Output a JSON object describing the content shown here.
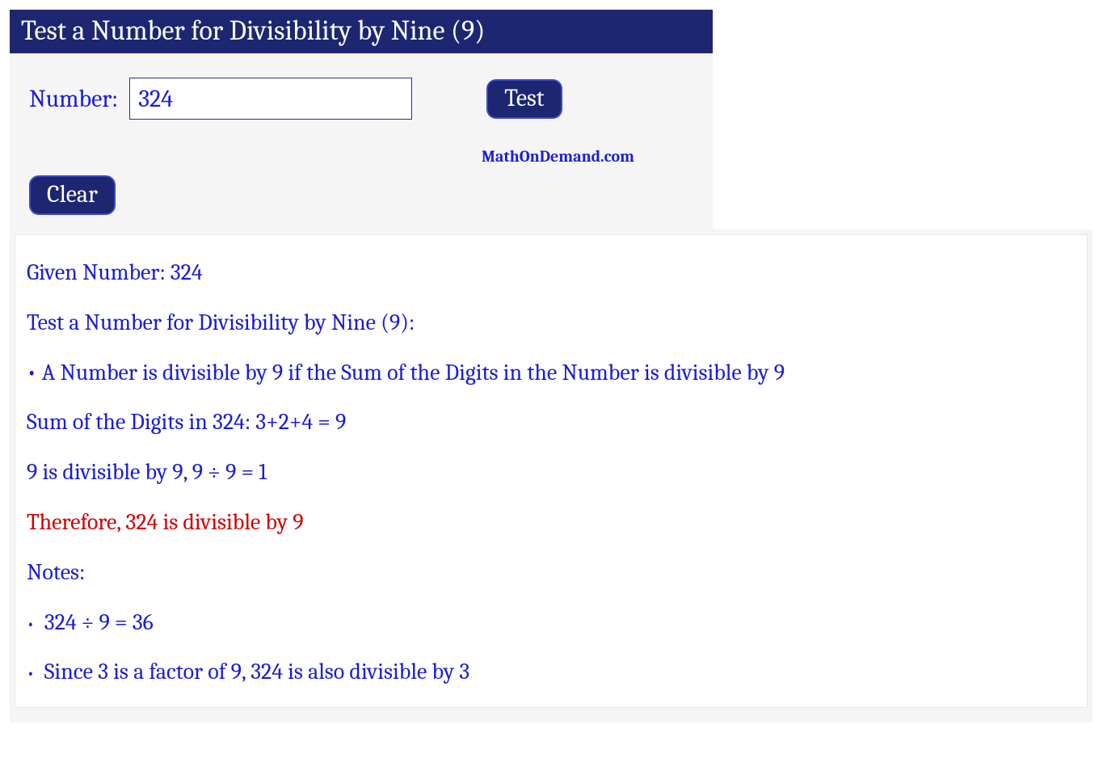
{
  "header": {
    "title": "Test a Number for Divisibility by Nine (9)"
  },
  "form": {
    "number_label": "Number:",
    "number_value": "324",
    "test_label": "Test",
    "clear_label": "Clear",
    "site_link": "MathOnDemand.com"
  },
  "results": {
    "given": "Given Number: 324",
    "heading": "Test a Number for Divisibility by Nine (9):",
    "rule": "• A Number is divisible by 9 if the Sum of the Digits in the Number is divisible by 9",
    "sum_line": "Sum of the Digits in 324: 3+2+4 = 9",
    "div_line": "9 is divisible by 9, 9 ÷ 9 = 1",
    "conclusion": "Therefore, 324 is divisible by 9",
    "notes_label": "Notes:",
    "note1": "324 ÷ 9 = 36",
    "note2": "Since 3 is a factor of 9, 324 is also divisible by 3"
  }
}
